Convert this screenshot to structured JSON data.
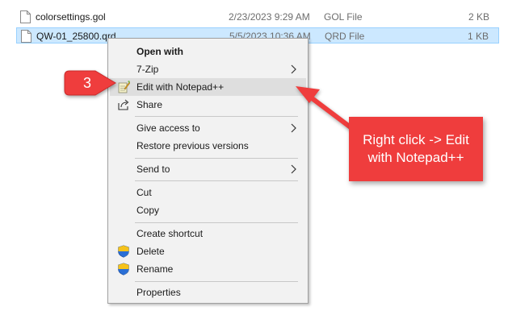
{
  "files": [
    {
      "name": "colorsettings.gol",
      "date": "2/23/2023 9:29 AM",
      "type": "GOL File",
      "size": "2 KB",
      "selected": false
    },
    {
      "name": "QW-01_25800.qrd",
      "date": "5/5/2023 10:36 AM",
      "type": "QRD File",
      "size": "1 KB",
      "selected": true
    }
  ],
  "context_menu": {
    "items": [
      {
        "label": "Open with",
        "icon": "",
        "submenu": false
      },
      {
        "label": "7-Zip",
        "icon": "",
        "submenu": true
      },
      {
        "label": "Edit with Notepad++",
        "icon": "notepad-plus-plus-icon",
        "submenu": false
      },
      {
        "label": "Share",
        "icon": "share-icon",
        "submenu": false
      },
      {
        "label": "Give access to",
        "icon": "",
        "submenu": true
      },
      {
        "label": "Restore previous versions",
        "icon": "",
        "submenu": false
      },
      {
        "label": "Send to",
        "icon": "",
        "submenu": true
      },
      {
        "label": "Cut",
        "icon": "",
        "submenu": false
      },
      {
        "label": "Copy",
        "icon": "",
        "submenu": false
      },
      {
        "label": "Create shortcut",
        "icon": "",
        "submenu": false
      },
      {
        "label": "Delete",
        "icon": "uac-shield-icon",
        "submenu": false
      },
      {
        "label": "Rename",
        "icon": "uac-shield-icon",
        "submenu": false
      },
      {
        "label": "Properties",
        "icon": "",
        "submenu": false
      }
    ]
  },
  "annotation": {
    "step_number": "3",
    "callout_text": "Right click -> Edit\nwith Notepad++",
    "color": "#ef3d3d"
  }
}
